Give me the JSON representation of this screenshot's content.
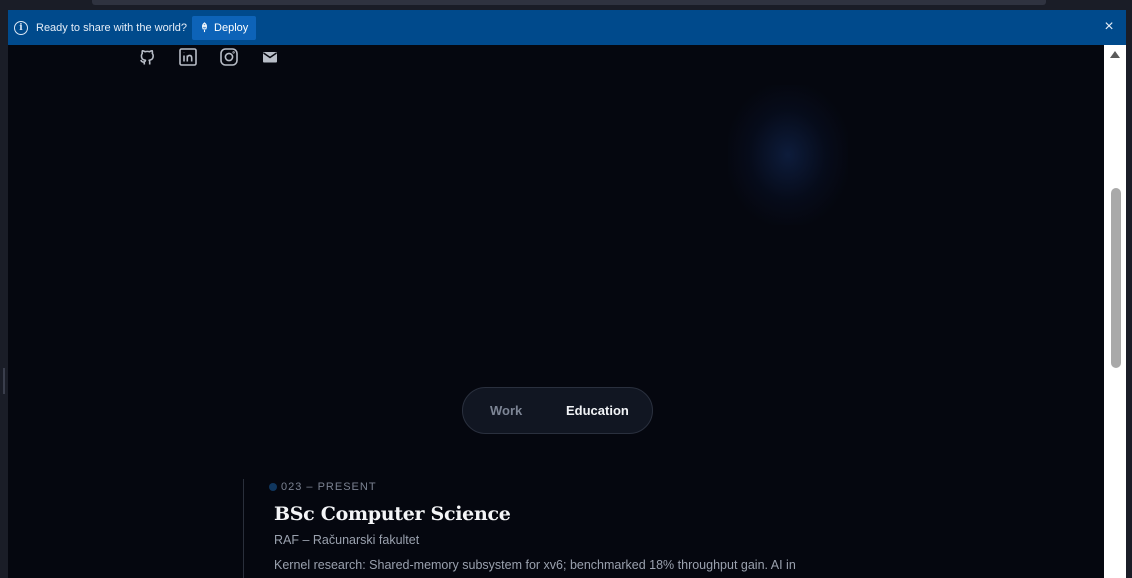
{
  "banner": {
    "info_icon": "info-icon",
    "message": "Ready to share with the world?",
    "deploy_icon": "rocket-icon",
    "deploy_label": "Deploy",
    "close_icon": "close-icon"
  },
  "socials": [
    {
      "name": "github-icon"
    },
    {
      "name": "linkedin-icon"
    },
    {
      "name": "instagram-icon"
    },
    {
      "name": "mail-icon"
    }
  ],
  "toggle": {
    "work_label": "Work",
    "education_label": "Education",
    "selected": "Education"
  },
  "education": [
    {
      "date": "023 – PRESENT",
      "title": "BSc Computer Science",
      "school": "RAF – Računarski fakultet",
      "description": "Kernel research: Shared-memory subsystem for xv6; benchmarked 18% throughput gain. AI in"
    }
  ],
  "colors": {
    "banner_bg": "#004a8c",
    "deploy_bg": "#0d63b8",
    "page_bg": "#05070f",
    "accent_dot": "#10365e"
  }
}
